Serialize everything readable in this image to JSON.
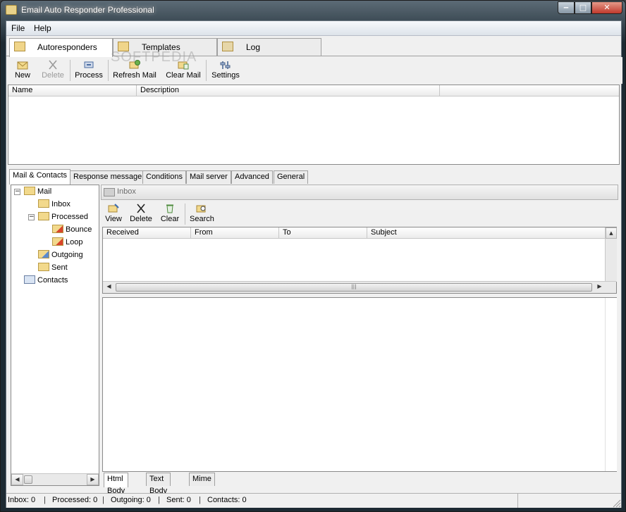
{
  "window": {
    "title": "Email Auto Responder Professional"
  },
  "menu": {
    "file": "File",
    "help": "Help"
  },
  "main_tabs": [
    {
      "label": "Autoresponders",
      "active": true
    },
    {
      "label": "Templates",
      "active": false
    },
    {
      "label": "Log",
      "active": false
    }
  ],
  "toolbar": {
    "new": "New",
    "delete": "Delete",
    "process": "Process",
    "refresh_mail": "Refresh Mail",
    "clear_mail": "Clear Mail",
    "settings": "Settings"
  },
  "watermark": "SOFTPEDIA",
  "autoresponders_list": {
    "columns": [
      "Name",
      "Description"
    ]
  },
  "sub_tabs": [
    "Mail & Contacts",
    "Response message",
    "Conditions",
    "Mail server",
    "Advanced",
    "General"
  ],
  "tree": {
    "mail": "Mail",
    "inbox": "Inbox",
    "processed": "Processed",
    "bounce": "Bounce",
    "loop": "Loop",
    "outgoing": "Outgoing",
    "sent": "Sent",
    "contacts": "Contacts"
  },
  "folder": {
    "current": "Inbox"
  },
  "mail_toolbar": {
    "view": "View",
    "delete": "Delete",
    "clear": "Clear",
    "search": "Search"
  },
  "mail_list": {
    "columns": [
      "Received",
      "From",
      "To",
      "Subject"
    ]
  },
  "body_tabs": [
    "Html Body",
    "Text Body",
    "Mime"
  ],
  "status": {
    "inbox": "Inbox: 0",
    "processed": "Processed: 0",
    "outgoing": "Outgoing: 0",
    "sent": "Sent: 0",
    "contacts": "Contacts: 0",
    "separator": "|"
  },
  "colors": {
    "folder": "#f2d98c",
    "title_text": "#ffffff",
    "close_button": "#c1392b"
  }
}
